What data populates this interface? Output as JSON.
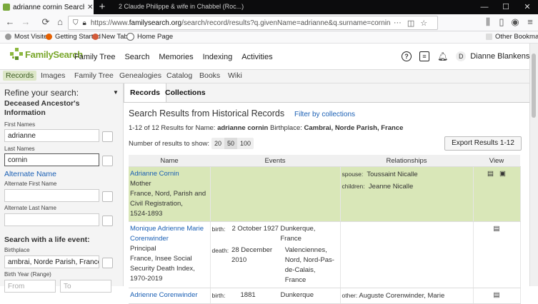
{
  "browser": {
    "tab_title": "adrianne cornin Search Results",
    "tab_text": "2 Claude Philippe & wife in Chabbel (Roc...)",
    "url_prefix": "https://www.",
    "url_domain": "familysearch.org",
    "url_rest": "/search/record/results?q.givenName=adrianne&q.surname=cornin&q.birthLikePl...",
    "bookmarks": [
      "Most Visited",
      "Getting Started",
      "New Tab",
      "Home Page"
    ],
    "other_bookmarks": "Other Bookmarks"
  },
  "header": {
    "logo": "FamilySearch",
    "nav": [
      "Family Tree",
      "Search",
      "Memories",
      "Indexing",
      "Activities"
    ],
    "avatar_initial": "D",
    "user_name": "Dianne Blankens..."
  },
  "subnav": [
    "Records",
    "Images",
    "Family Tree",
    "Genealogies",
    "Catalog",
    "Books",
    "Wiki"
  ],
  "sidebar": {
    "title": "Refine your search:",
    "section1": "Deceased Ancestor's Information",
    "first_names_label": "First Names",
    "first_names_value": "adrianne",
    "last_names_label": "Last Names",
    "last_names_value": "cornin",
    "alternate_name": "Alternate Name",
    "alt_first_label": "Alternate First Name",
    "alt_last_label": "Alternate Last Name",
    "life_event": "Search with a life event:",
    "birthplace_label": "Birthplace",
    "birthplace_value": "ambrai, Norde Parish, France",
    "birth_year_label": "Birth Year (Range)",
    "from_placeholder": "From",
    "to_placeholder": "To"
  },
  "main": {
    "tabs": [
      "Records",
      "Collections"
    ],
    "heading": "Search Results from Historical Records",
    "filter_link": "Filter by collections",
    "summary_prefix": "1-12 of 12 Results for Name:",
    "summary_name": "adrianne cornin",
    "summary_bp_label": "Birthplace:",
    "summary_bp": "Cambrai, Norde Parish, France",
    "show_label": "Number of results to show:",
    "show_options": [
      "20",
      "50",
      "100"
    ],
    "export": "Export Results 1-12",
    "columns": [
      "Name",
      "Events",
      "Relationships",
      "View"
    ],
    "rows": [
      {
        "name": "Adrianne Cornin",
        "detail": [
          "Mother",
          "France, Nord, Parish and",
          "Civil Registration,",
          "1524-1893"
        ],
        "events": [],
        "rel": [
          [
            "spouse:",
            "Toussaint Nicalle"
          ],
          [
            "children:",
            "Jeanne Nicalle"
          ]
        ]
      },
      {
        "name": "Monique Adrienne Marie Corenwinder",
        "detail": [
          "Principal",
          "France, Insee Social",
          "Security Death Index,",
          "1970-2019"
        ],
        "events": [
          [
            "birth:",
            "2 October 1927",
            "Dunkerque, France"
          ],
          [
            "death:",
            "28 December 2010",
            "Valenciennes, Nord, Nord-Pas-de-Calais, France"
          ]
        ],
        "rel": []
      },
      {
        "name": "Adrienne Corenwinder",
        "detail": [],
        "events": [
          [
            "birth:",
            "1881",
            "Dunkerque"
          ]
        ],
        "rel": [
          [
            "other:",
            "Auguste Corenwinder, Marie"
          ]
        ]
      }
    ]
  }
}
